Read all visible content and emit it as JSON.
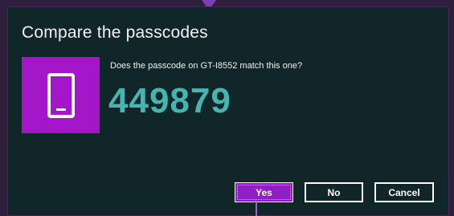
{
  "dialog": {
    "title": "Compare the passcodes",
    "prompt": "Does the passcode on GT-I8552 match this one?",
    "passcode": "449879",
    "device_icon": "phone-icon"
  },
  "buttons": {
    "yes_label": "Yes",
    "no_label": "No",
    "cancel_label": "Cancel"
  },
  "colors": {
    "background": "#2d1f3d",
    "dialog_background": "#102628",
    "accent": "#a317c9",
    "passcode": "#46b4b0",
    "text": "#f2f2f2"
  }
}
